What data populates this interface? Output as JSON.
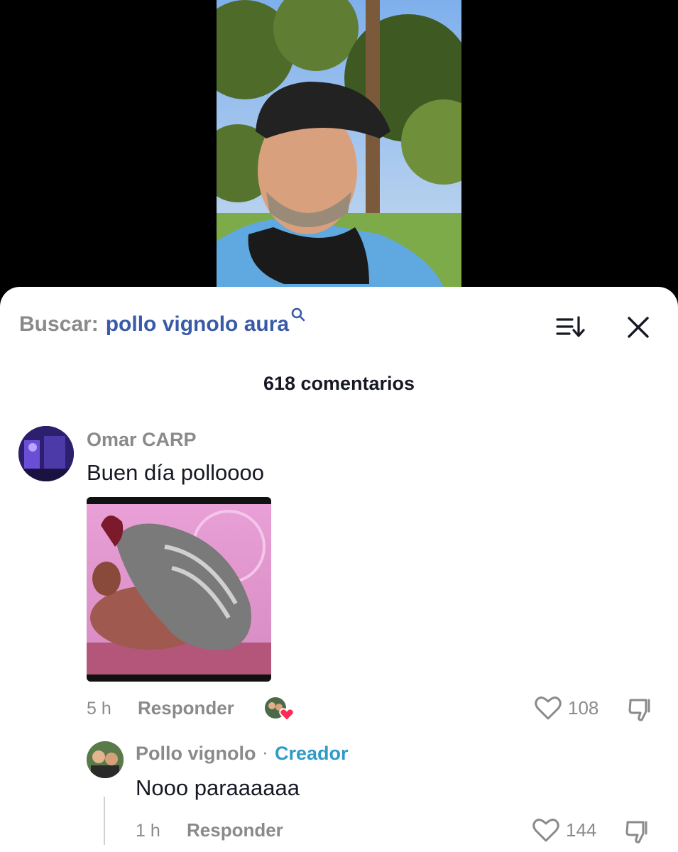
{
  "search": {
    "prefix": "Buscar:",
    "query": "pollo vignolo aura"
  },
  "comments_count": "618 comentarios",
  "icons": {
    "search": "search-icon",
    "sort": "sort-icon",
    "close": "close-icon",
    "like": "heart-icon",
    "dislike": "dislike-icon"
  },
  "comments": [
    {
      "username": "Omar CARP",
      "text": "Buen día polloooo",
      "time": "5 h",
      "reply_label": "Responder",
      "likes": "108",
      "creator_liked": true
    }
  ],
  "reply": {
    "username": "Pollo vignolo",
    "separator": "·",
    "badge": "Creador",
    "text": "Nooo paraaaaaa",
    "time": "1 h",
    "reply_label": "Responder",
    "likes": "144"
  },
  "colors": {
    "accent": "#3a5aa8",
    "creator_badge": "#2f9bc7",
    "muted": "#8a8a8a",
    "heart": "#fe2c55"
  }
}
